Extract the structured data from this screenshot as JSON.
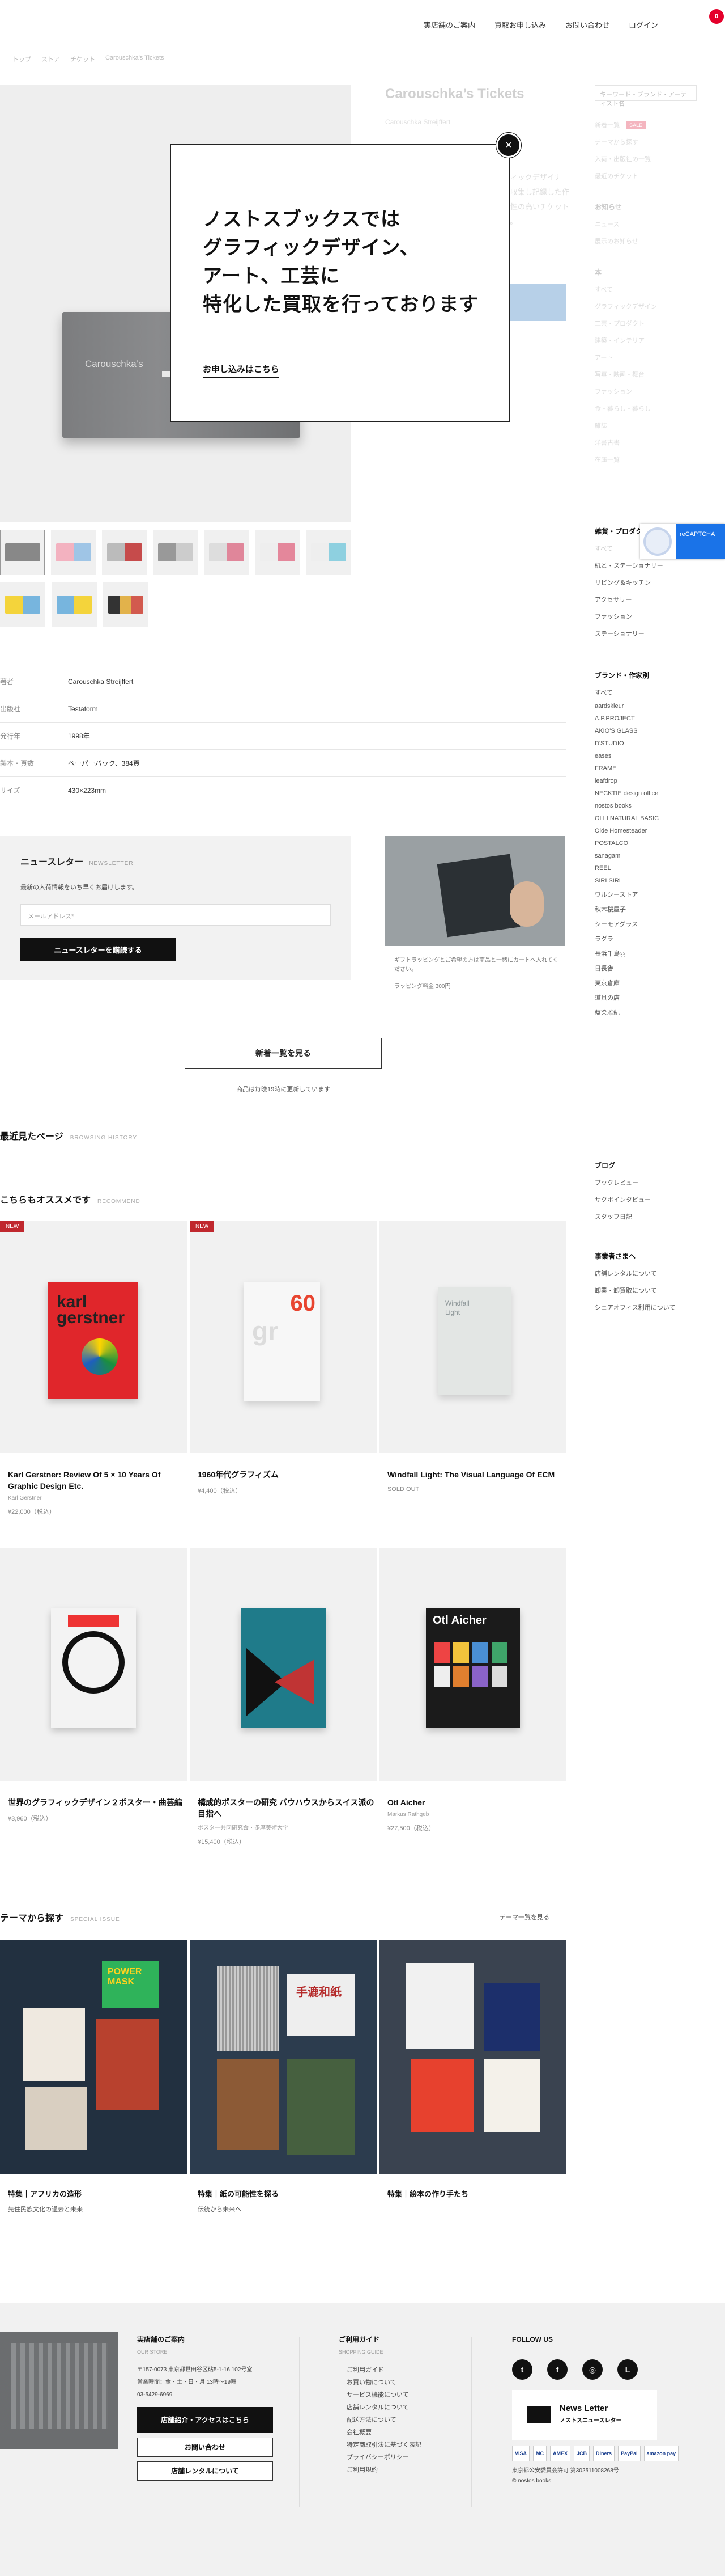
{
  "header": {
    "nav": [
      "実店舗のご案内",
      "買取お申し込み",
      "お問い合わせ",
      "ログイン"
    ],
    "cart_count": "0",
    "breadcrumb": [
      "トップ",
      "ストア",
      "チケット",
      "Carouschka's Tickets"
    ]
  },
  "product": {
    "title": "Carouschka’s Tickets",
    "subtitle": "Carouschka Streijffert",
    "description": "〇〇〇〇グラフィックデザイナー、チケットを収集し記録した作品集。デザイン性の高いチケットのコレクション。",
    "thumbs_count": 11
  },
  "modal": {
    "close": "×",
    "heading": "ノストスブックスでは\nグラフィックデザイン、\nアート、工芸に\n特化した買取を行っております",
    "link": "お申し込みはこちら"
  },
  "sidebar": {
    "search_placeholder": "キーワード・ブランド・アーティスト名",
    "faded_top": [
      "新着一覧",
      "セール",
      "テーマから探す",
      "入荷・出版社の一覧",
      "最近のチケット"
    ],
    "sale_badge": "SALE",
    "faded_mid_head": "お知らせ",
    "faded_mid": [
      "ニュース",
      "展示のお知らせ"
    ],
    "faded_cat_head": "本",
    "faded_cats": [
      "すべて",
      "グラフィックデザイン",
      "工芸・プロダクト",
      "建築・インテリア",
      "アート",
      "写真・映画・舞台",
      "ファッション",
      "食・暮らし・暮らし",
      "雑誌",
      "ノスタルジック",
      "洋書古書",
      "在庫一覧"
    ],
    "goods_head": "雑貨・プロダクト",
    "goods": [
      "すべて",
      "紙と・ステーショナリー",
      "リビング＆キッチン",
      "ステーショナリー",
      "アクセサリー",
      "アパレル",
      "ファッション",
      "ステーショナリー"
    ],
    "brand_head": "ブランド・作家別",
    "brands": [
      "すべて",
      "aardskleur",
      "A.P.PROJECT",
      "AKIO'S GLASS",
      "D'STUDIO",
      "eases",
      "FRAME",
      "leafdrop",
      "NECKTIE design office",
      "nostos books",
      "OLLI NATURAL BASIC",
      "Olde Homesteader",
      "POSTALCO",
      "sanagam",
      "REEL",
      "SIRI SIRI",
      "ワルシーストア",
      "秋木桜屋子",
      "シーモアグラス",
      "ラグラ",
      "長浜千鳥羽",
      "日長舎",
      "東京倉庫",
      "道具の店",
      "藍染雅紀"
    ],
    "blog_head": "ブログ",
    "blog": [
      "ブックレビュー",
      "サクボインタビュー",
      "スタッフ日記"
    ],
    "biz_head": "事業者さまへ",
    "biz": [
      "店舗レンタルについて",
      "卸業・卸買取について",
      "シェアオフィス利用について"
    ],
    "recaptcha": "reCAPTCHA"
  },
  "specs": [
    {
      "k": "著者",
      "v": "Carouschka Streijffert"
    },
    {
      "k": "出版社",
      "v": "Testaform"
    },
    {
      "k": "発行年",
      "v": "1998年"
    },
    {
      "k": "製本・頁数",
      "v": "ペーパーバック、384頁"
    },
    {
      "k": "サイズ",
      "v": "430×223mm"
    }
  ],
  "newsletter": {
    "title": "ニュースレター",
    "title_en": "NEWSLETTER",
    "desc": "最新の入荷情報をいち早くお届けします。",
    "placeholder": "メールアドレス*",
    "button": "ニュースレターを購読する"
  },
  "gift": {
    "text": "ギフトラッピングとご希望の方は商品と一緒にカートへ入れてください。",
    "price": "ラッピング料金 300円"
  },
  "all_button": "新着一覧を見る",
  "all_note": "商品は毎晩19時に更新しています",
  "recent": {
    "title": "最近見たページ",
    "en": "BROWSING HISTORY"
  },
  "recommend": {
    "title": "こちらもオススメです",
    "en": "RECOMMEND",
    "items": [
      {
        "title": "Karl Gerstner: Review Of 5 × 10 Years Of Graphic Design Etc.",
        "author": "Karl Gerstner",
        "price": "¥22,000（税込）",
        "badge": "NEW"
      },
      {
        "title": "1960年代グラフィズム",
        "author": "",
        "price": "¥4,400（税込）",
        "badge": "NEW"
      },
      {
        "title": "Windfall Light: The Visual Language Of ECM",
        "author": "",
        "price": "SOLD OUT",
        "badge": ""
      },
      {
        "title": "世界のグラフィックデザイン２ポスター・曲芸編",
        "author": "",
        "price": "¥3,960（税込）",
        "badge": ""
      },
      {
        "title": "構成的ポスターの研究 バウハウスからスイス派の目指へ",
        "author": "ポスター共同研究会・多摩美術大学",
        "price": "¥15,400（税込）",
        "badge": ""
      },
      {
        "title": "Otl Aicher",
        "author": "Markus Rathgeb",
        "price": "¥27,500（税込）",
        "badge": ""
      }
    ]
  },
  "themes": {
    "title": "テーマから探す",
    "en": "SPECIAL ISSUE",
    "more": "テーマ一覧を見る",
    "items": [
      {
        "title": "特集｜アフリカの造形",
        "sub": "先住民族文化の過去と未来",
        "label": "POWER MASK"
      },
      {
        "title": "特集｜紙の可能性を探る",
        "sub": "伝統から未来へ",
        "label": "手漉和紙"
      },
      {
        "title": "特集｜絵本の作り手たち",
        "sub": "",
        "label": ""
      }
    ]
  },
  "footer": {
    "store_head": "実店舗のご案内",
    "store_en": "OUR STORE",
    "address": "〒157-0073 東京都世田谷区砧5-1-16 102号室",
    "hours": "営業時間：金・土・日・月 13時〜19時",
    "tel": "03-5429-6969",
    "btn_store": "店舗紹介・アクセスはこちら",
    "btn_contact": "お問い合わせ",
    "btn_rental": "店舗レンタルについて",
    "guide_head": "ご利用ガイド",
    "guide_en": "SHOPPING GUIDE",
    "guide": [
      "ご利用ガイド",
      "お買い物について",
      "サービス機能について",
      "店舗レンタルについて",
      "配送方法について",
      "会社概要",
      "特定商取引法に基づく表記",
      "プライバシーポリシー",
      "ご利用規約"
    ],
    "follow_head": "FOLLOW US",
    "social": [
      "twitter-icon",
      "facebook-icon",
      "instagram-icon",
      "line-icon"
    ],
    "social_glyphs": [
      "t",
      "f",
      "◎",
      "L"
    ],
    "nl_title": "News Letter",
    "nl_sub": "ノストスニュースレター",
    "payments": [
      "VISA",
      "MC",
      "AMEX",
      "JCB",
      "Diners",
      "PayPal",
      "amazon pay"
    ],
    "license": "東京都公安委員会許可 第302511008268号",
    "copyright": "© nostos books"
  }
}
